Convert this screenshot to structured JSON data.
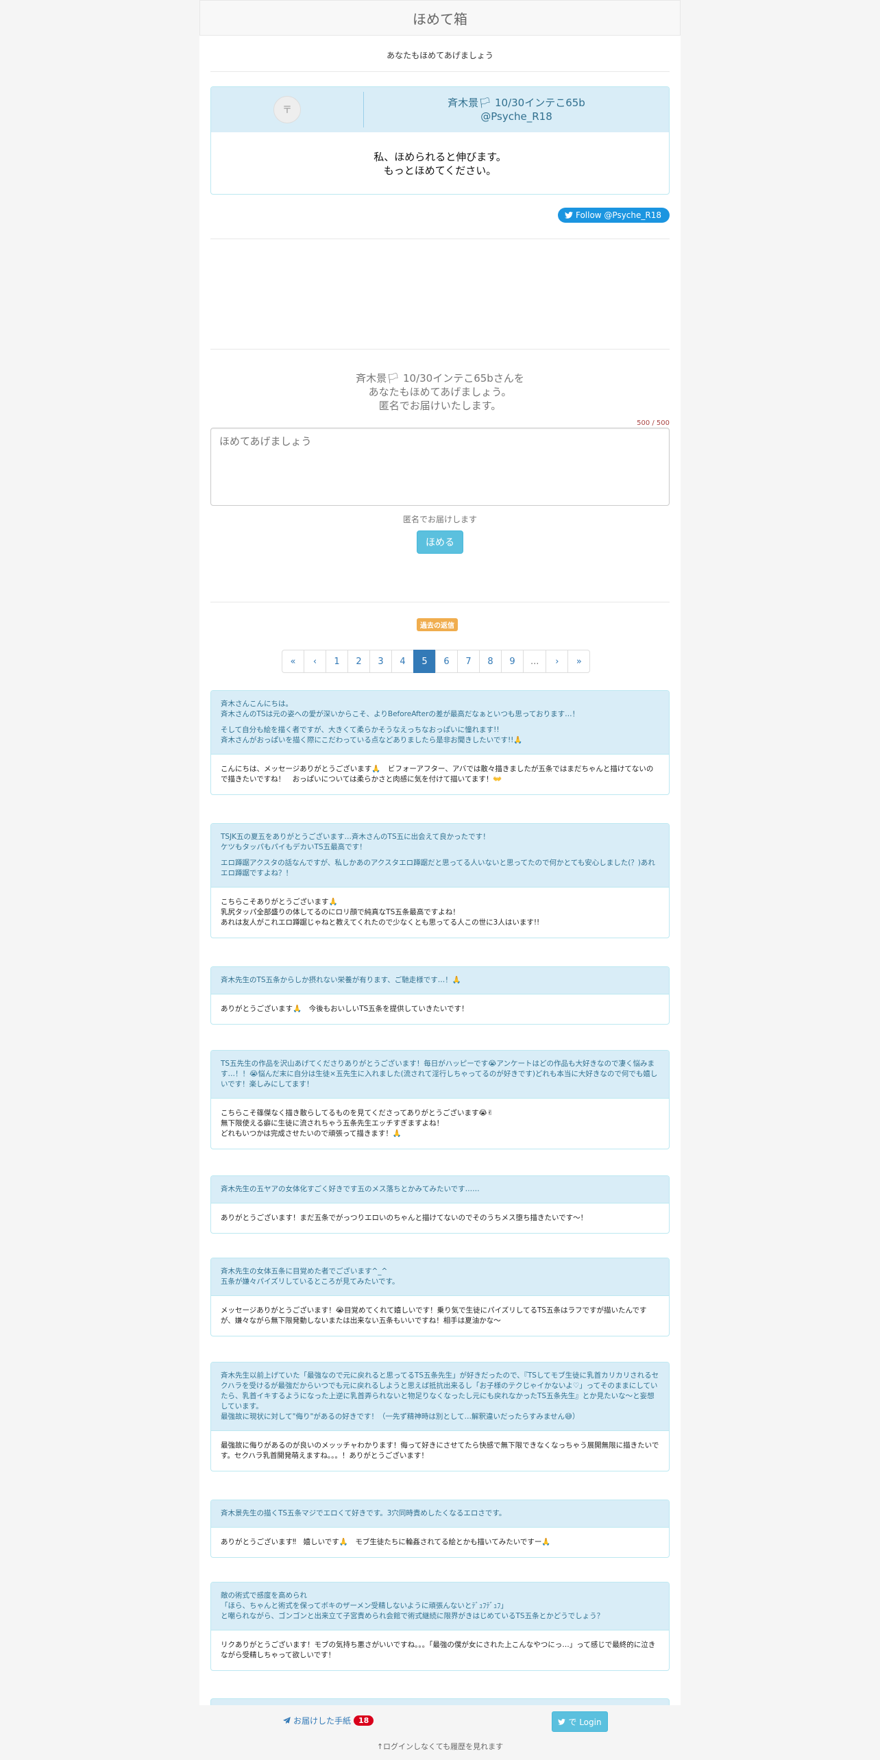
{
  "header": {
    "title": "ほめて箱"
  },
  "tagline": "あなたもほめてあげましょう",
  "profile": {
    "avatar_glyph": "〒",
    "name": "斉木景🏳 10/30インテこ65b",
    "handle": "@Psyche_R18",
    "message_line1": "私、ほめられると伸びます。",
    "message_line2": "もっとほめてください。"
  },
  "follow": {
    "label": "Follow @Psyche_R18",
    "icon": "twitter-bird-icon"
  },
  "compose": {
    "line1": "斉木景🏳 10/30インテこ65bさんを",
    "line2": "あなたもほめてあげましょう。",
    "line3": "匿名でお届けいたします。",
    "counter": "500 / 500",
    "placeholder": "ほめてあげましょう",
    "anon_note": "匿名でお届けします",
    "submit_label": "ほめる"
  },
  "history_label": "過去の返信",
  "pagination": {
    "items": [
      "«",
      "‹",
      "1",
      "2",
      "3",
      "4",
      "5",
      "6",
      "7",
      "8",
      "9",
      "...",
      "›",
      "»"
    ],
    "active": "5"
  },
  "letters": [
    {
      "q": [
        "斉木さんこんにちは。\n斉木さんのTSは元の姿への愛が深いからこそ、よりBeforeAfterの差が最高だなぁといつも思っております…！",
        "そして自分も絵を描く者ですが、大きくて柔らかそうなえっちなおっぱいに憧れます!!\n斉木さんがおっぱいを描く際にこだわっている点などありましたら是非お聞きしたいです!!🙏"
      ],
      "a": "こんにちは、メッセージありがとうございます🙏　ビフォーアフター、アバでは散々描きましたが五条ではまだちゃんと描けてないので描きたいですね！　おっぱいについては柔らかさと肉感に気を付けて描いてます！👐"
    },
    {
      "q": [
        "TSJK五の夏五をありがとうございます…斉木さんのTS五に出会えて良かったです！\nケツもタッパもパイもデカいTS五最高です！",
        "エロ蹲踞アクスタの話なんですが、私しかあのアクスタエロ蹲踞だと思ってる人いないと思ってたので何かとても安心しました(？)あれエロ蹲踞ですよね？！"
      ],
      "a": "こちらこそありがとうございます🙏\n乳尻タッパ全部盛りの体してるのにロリ顔で純真なTS五条最高ですよね！\nあれは友人がこれエロ蹲踞じゃねと教えてくれたので少なくとも思ってる人この世に3人はいます!!"
    },
    {
      "q": [
        "斉木先生のTS五条からしか摂れない栄養が有ります、ご馳走様です…！🙏"
      ],
      "a": "ありがとうございます🙏　今後もおいしいTS五条を提供していきたいです！"
    },
    {
      "q": [
        "TS五先生の作品を沢山あげてくださりありがとうございます！毎日がハッピーです😭アンケートはどの作品も大好きなので凄く悩みます…！！😭悩んだ末に自分は生徒×五先生に入れました(流されて淫行しちゃってるのが好きです)どれも本当に大好きなので何でも嬉しいです！楽しみにしてます！"
      ],
      "a": "こちらこそ篠傑なく描き散らしてるものを見てくださってありがとうございます😭✌\n無下限使える癖に生徒に流されちゃう五条先生エッチすぎますよね！\nどれもいつかは完成させたいので頑張って描きます！🙏"
    },
    {
      "q": [
        "斉木先生の五ヤアの女体化すごく好きです五のメス落ちとかみてみたいです……"
      ],
      "a": "ありがとうございます！まだ五条でがっつりエロいのちゃんと描けてないのでそのうちメス堕ち描きたいです〜！"
    },
    {
      "q": [
        "斉木先生の女体五条に目覚めた者でございます^_^\n五条が嫌々パイズリしているところが見てみたいです。"
      ],
      "a": "メッセージありがとうございます！😭目覚めてくれて嬉しいです！乗り気で生徒にパイズリしてるTS五条はラフですが描いたんですが、嫌々ながら無下限発動しないまたは出来ない五条もいいですね！相手は夏油かな〜"
    },
    {
      "q": [
        "斉木先生以前上げていた「最強なので元に戻れると思ってるTS五条先生」が好きだったので、『TSしてモブ生徒に乳首カリカリされるセクハラを受けるが最強だからいつでも元に戻れるしようと思えば抵抗出来るし「お子様のテクじゃイかないよ♡」ってそのままにしていたら、乳首イキするようになった上逆に乳首弄られないと物足りなくなったし元にも戻れなかったTS五条先生』とか見たいな〜と妄想しています。\n最強故に現状に対して\"侮り\"があるの好きです！（一先ず精神時は別として…解釈違いだったらすみません😅）"
      ],
      "a": "最強故に侮りがあるのが良いのメッッチャわかります！侮って好きにさせてたら快感で無下限できなくなっちゃう展開無限に描きたいです。セクハラ乳首開発萌えますね。。。！ありがとうございます！"
    },
    {
      "q": [
        "斉木景先生の描くTS五条マジでエロくて好きです。3穴同時責めしたくなるエロさです。"
      ],
      "a": "ありがとうございます‼　嬉しいです🙏　モブ生徒たちに輪姦されてる絵とかも描いてみたいですー🙏"
    },
    {
      "q": [
        "敵の術式で感度を高められ\n「ほら、ちゃんと術式を保ってボキのザーメン受精しないように頑張んないとﾃﾞｭﾌﾃﾞｭﾌ」\nと嘲られながら、ゴンゴンと出来立て子宮責められ会館で術式継続に限界がきはじめているTS五条とかどうでしょう？"
      ],
      "a": "リクありがとうございます！モブの気持ち悪さがいいですね。。。「最強の僕が女にされた上こんなやつにっ…」って感じで最終的に泣きながら受精しちゃって欲しいです！"
    }
  ],
  "footer": {
    "letters_link": "お届けした手紙",
    "letters_icon": "paper-plane-icon",
    "letters_count": "18",
    "login_label": "で Login",
    "login_note": "↑ログインしなくても履歴を見れます"
  }
}
